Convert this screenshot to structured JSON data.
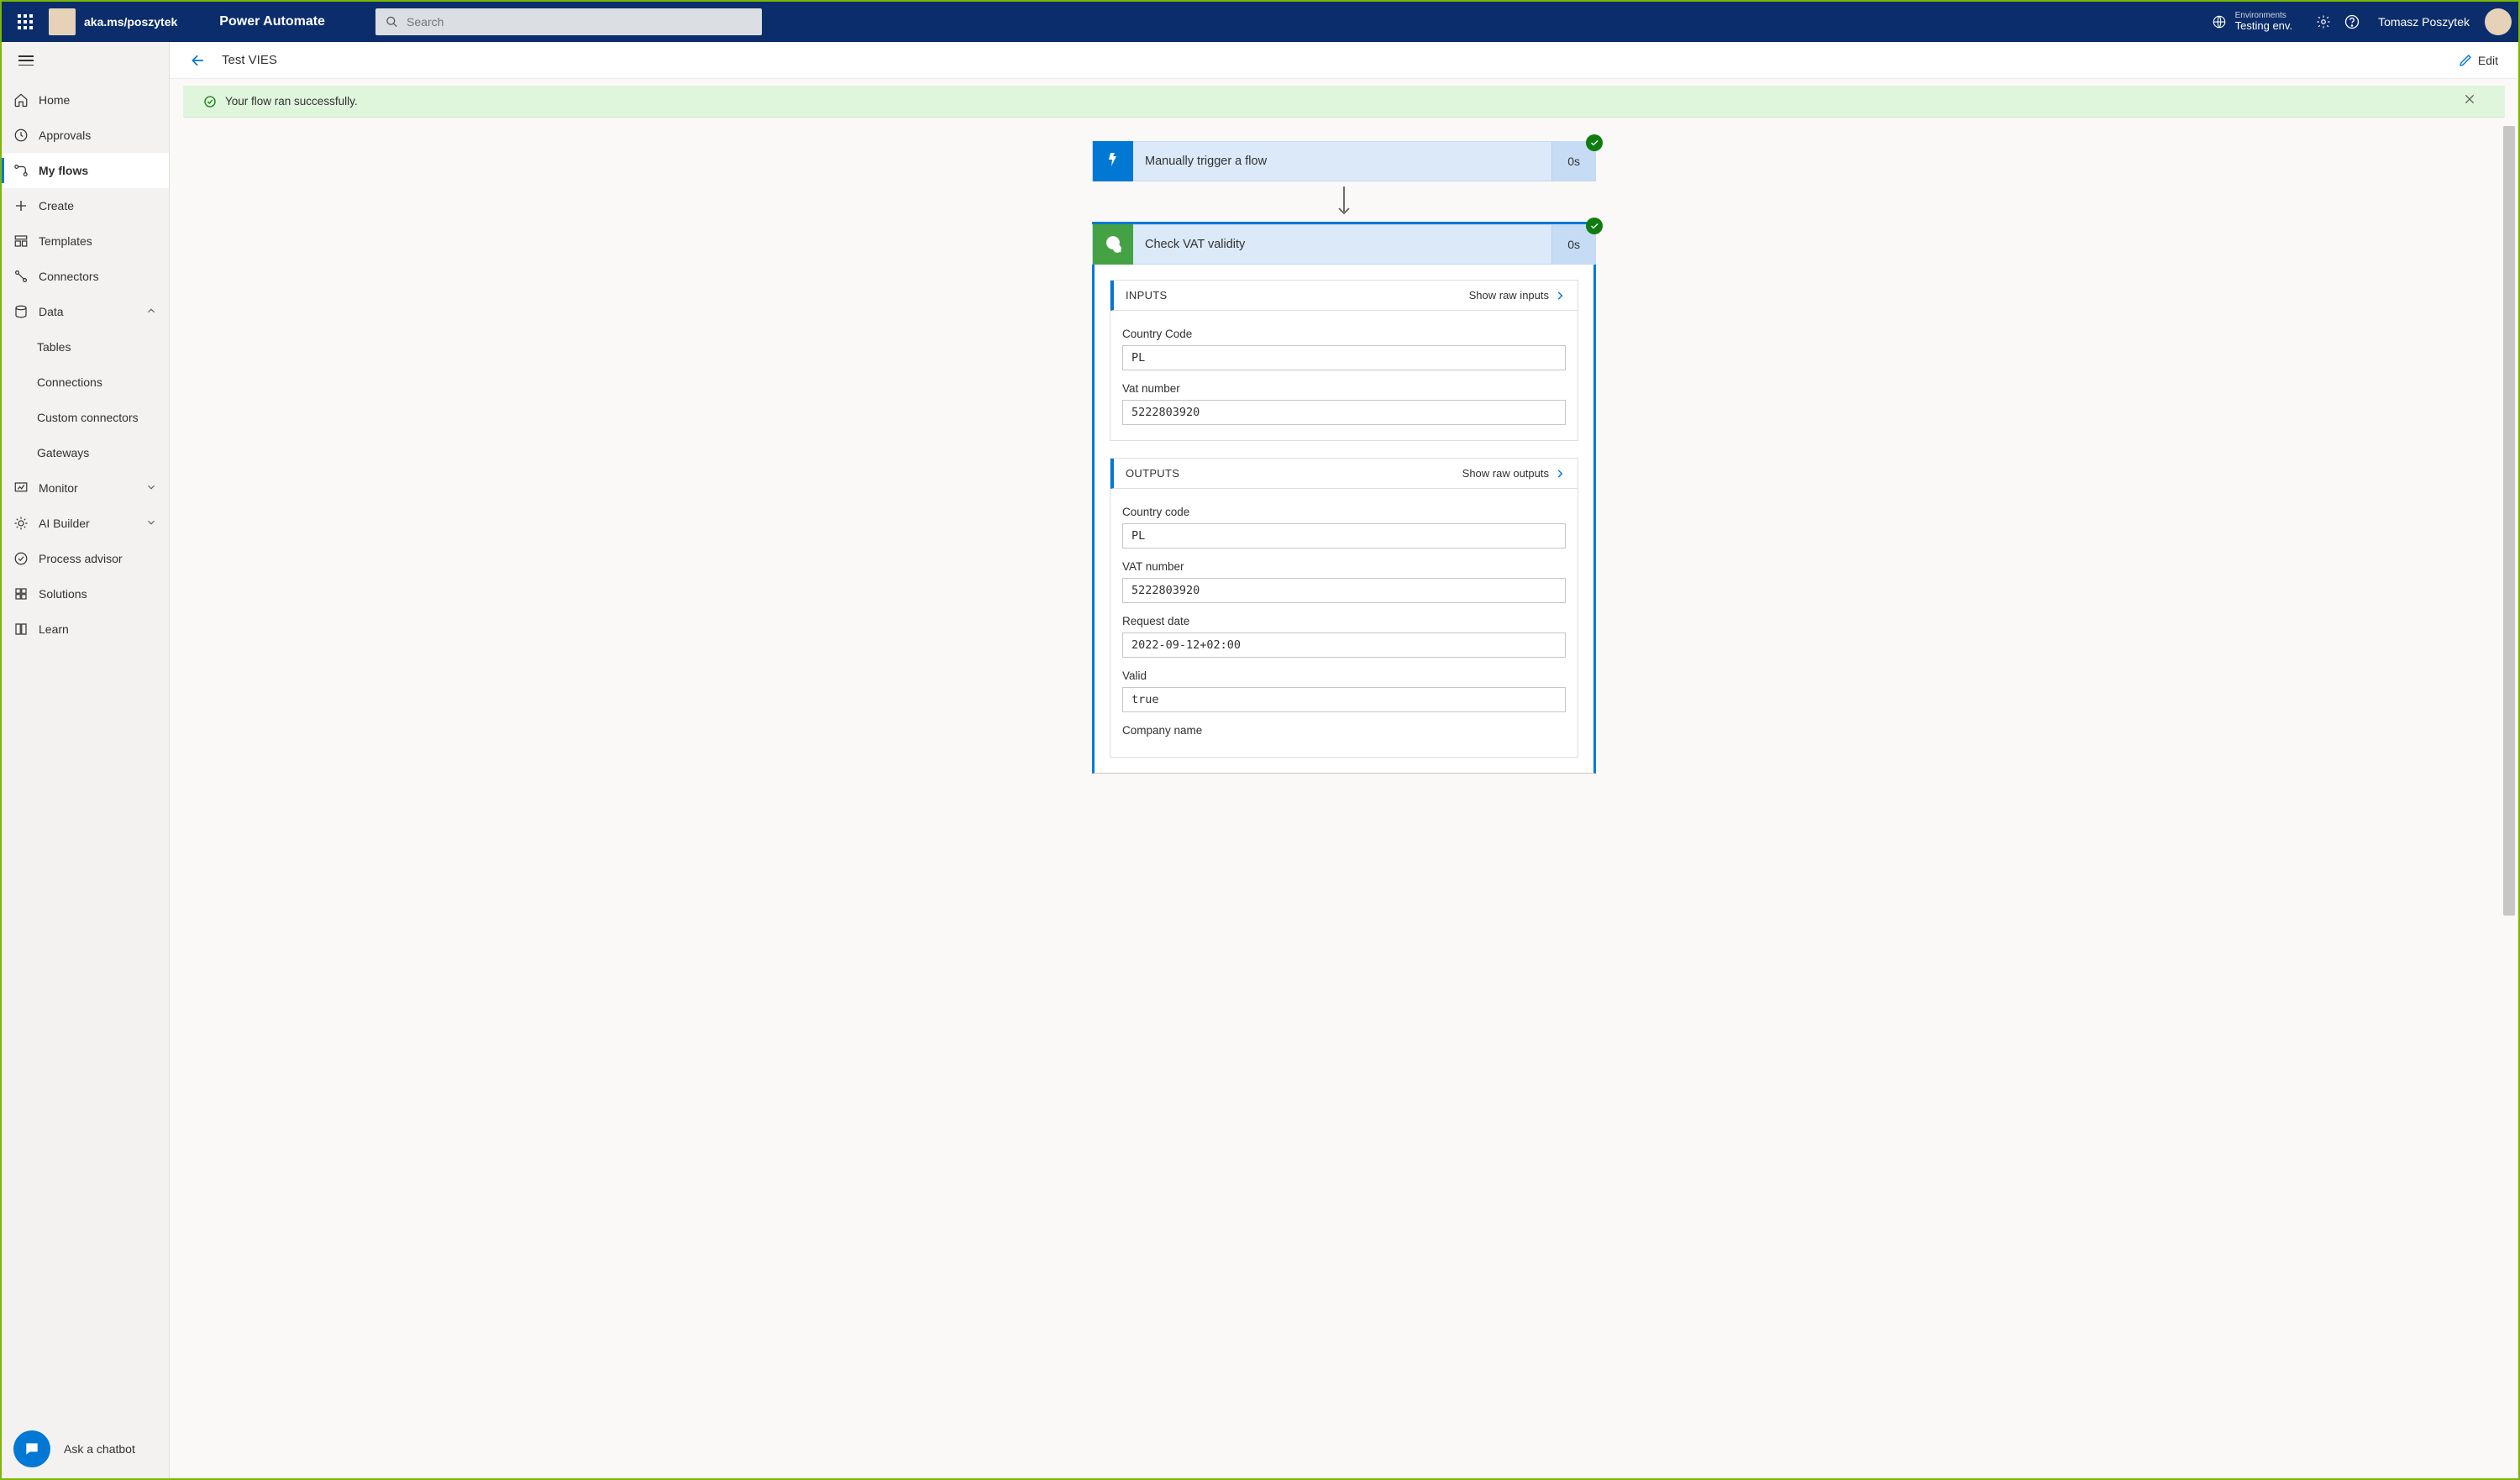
{
  "topbar": {
    "url_label": "aka.ms/poszytek",
    "brand": "Power Automate",
    "search_placeholder": "Search",
    "env_label": "Environments",
    "env_name": "Testing env.",
    "user_name": "Tomasz Poszytek"
  },
  "sidebar": {
    "items": [
      {
        "label": "Home"
      },
      {
        "label": "Approvals"
      },
      {
        "label": "My flows"
      },
      {
        "label": "Create"
      },
      {
        "label": "Templates"
      },
      {
        "label": "Connectors"
      },
      {
        "label": "Data"
      },
      {
        "label": "Tables"
      },
      {
        "label": "Connections"
      },
      {
        "label": "Custom connectors"
      },
      {
        "label": "Gateways"
      },
      {
        "label": "Monitor"
      },
      {
        "label": "AI Builder"
      },
      {
        "label": "Process advisor"
      },
      {
        "label": "Solutions"
      },
      {
        "label": "Learn"
      }
    ],
    "chatbot_label": "Ask a chatbot"
  },
  "page": {
    "title": "Test VIES",
    "edit_label": "Edit",
    "banner_text": "Your flow ran successfully."
  },
  "steps": {
    "trigger": {
      "title": "Manually trigger a flow",
      "duration": "0s"
    },
    "action": {
      "title": "Check VAT validity",
      "duration": "0s",
      "inputs_label": "INPUTS",
      "show_raw_inputs": "Show raw inputs",
      "outputs_label": "OUTPUTS",
      "show_raw_outputs": "Show raw outputs",
      "inputs": [
        {
          "label": "Country Code",
          "value": "PL"
        },
        {
          "label": "Vat number",
          "value": "5222803920"
        }
      ],
      "outputs": [
        {
          "label": "Country code",
          "value": "PL"
        },
        {
          "label": "VAT number",
          "value": "5222803920"
        },
        {
          "label": "Request date",
          "value": "2022-09-12+02:00"
        },
        {
          "label": "Valid",
          "value": "true"
        },
        {
          "label": "Company name",
          "value": ""
        }
      ]
    }
  }
}
